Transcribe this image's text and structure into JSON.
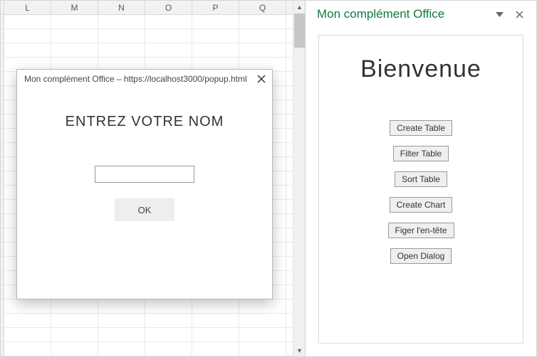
{
  "sheet": {
    "columns": [
      "L",
      "M",
      "N",
      "O",
      "P",
      "Q"
    ]
  },
  "dialog": {
    "title": "Mon complément Office – https://localhost3000/popup.html",
    "heading": "ENTREZ VOTRE NOM",
    "input_value": "",
    "ok_label": "OK"
  },
  "pane": {
    "title": "Mon complément Office",
    "welcome": "Bienvenue",
    "buttons": [
      "Create Table",
      "Filter Table",
      "Sort Table",
      "Create Chart",
      "Figer l'en-tête",
      "Open Dialog"
    ]
  }
}
